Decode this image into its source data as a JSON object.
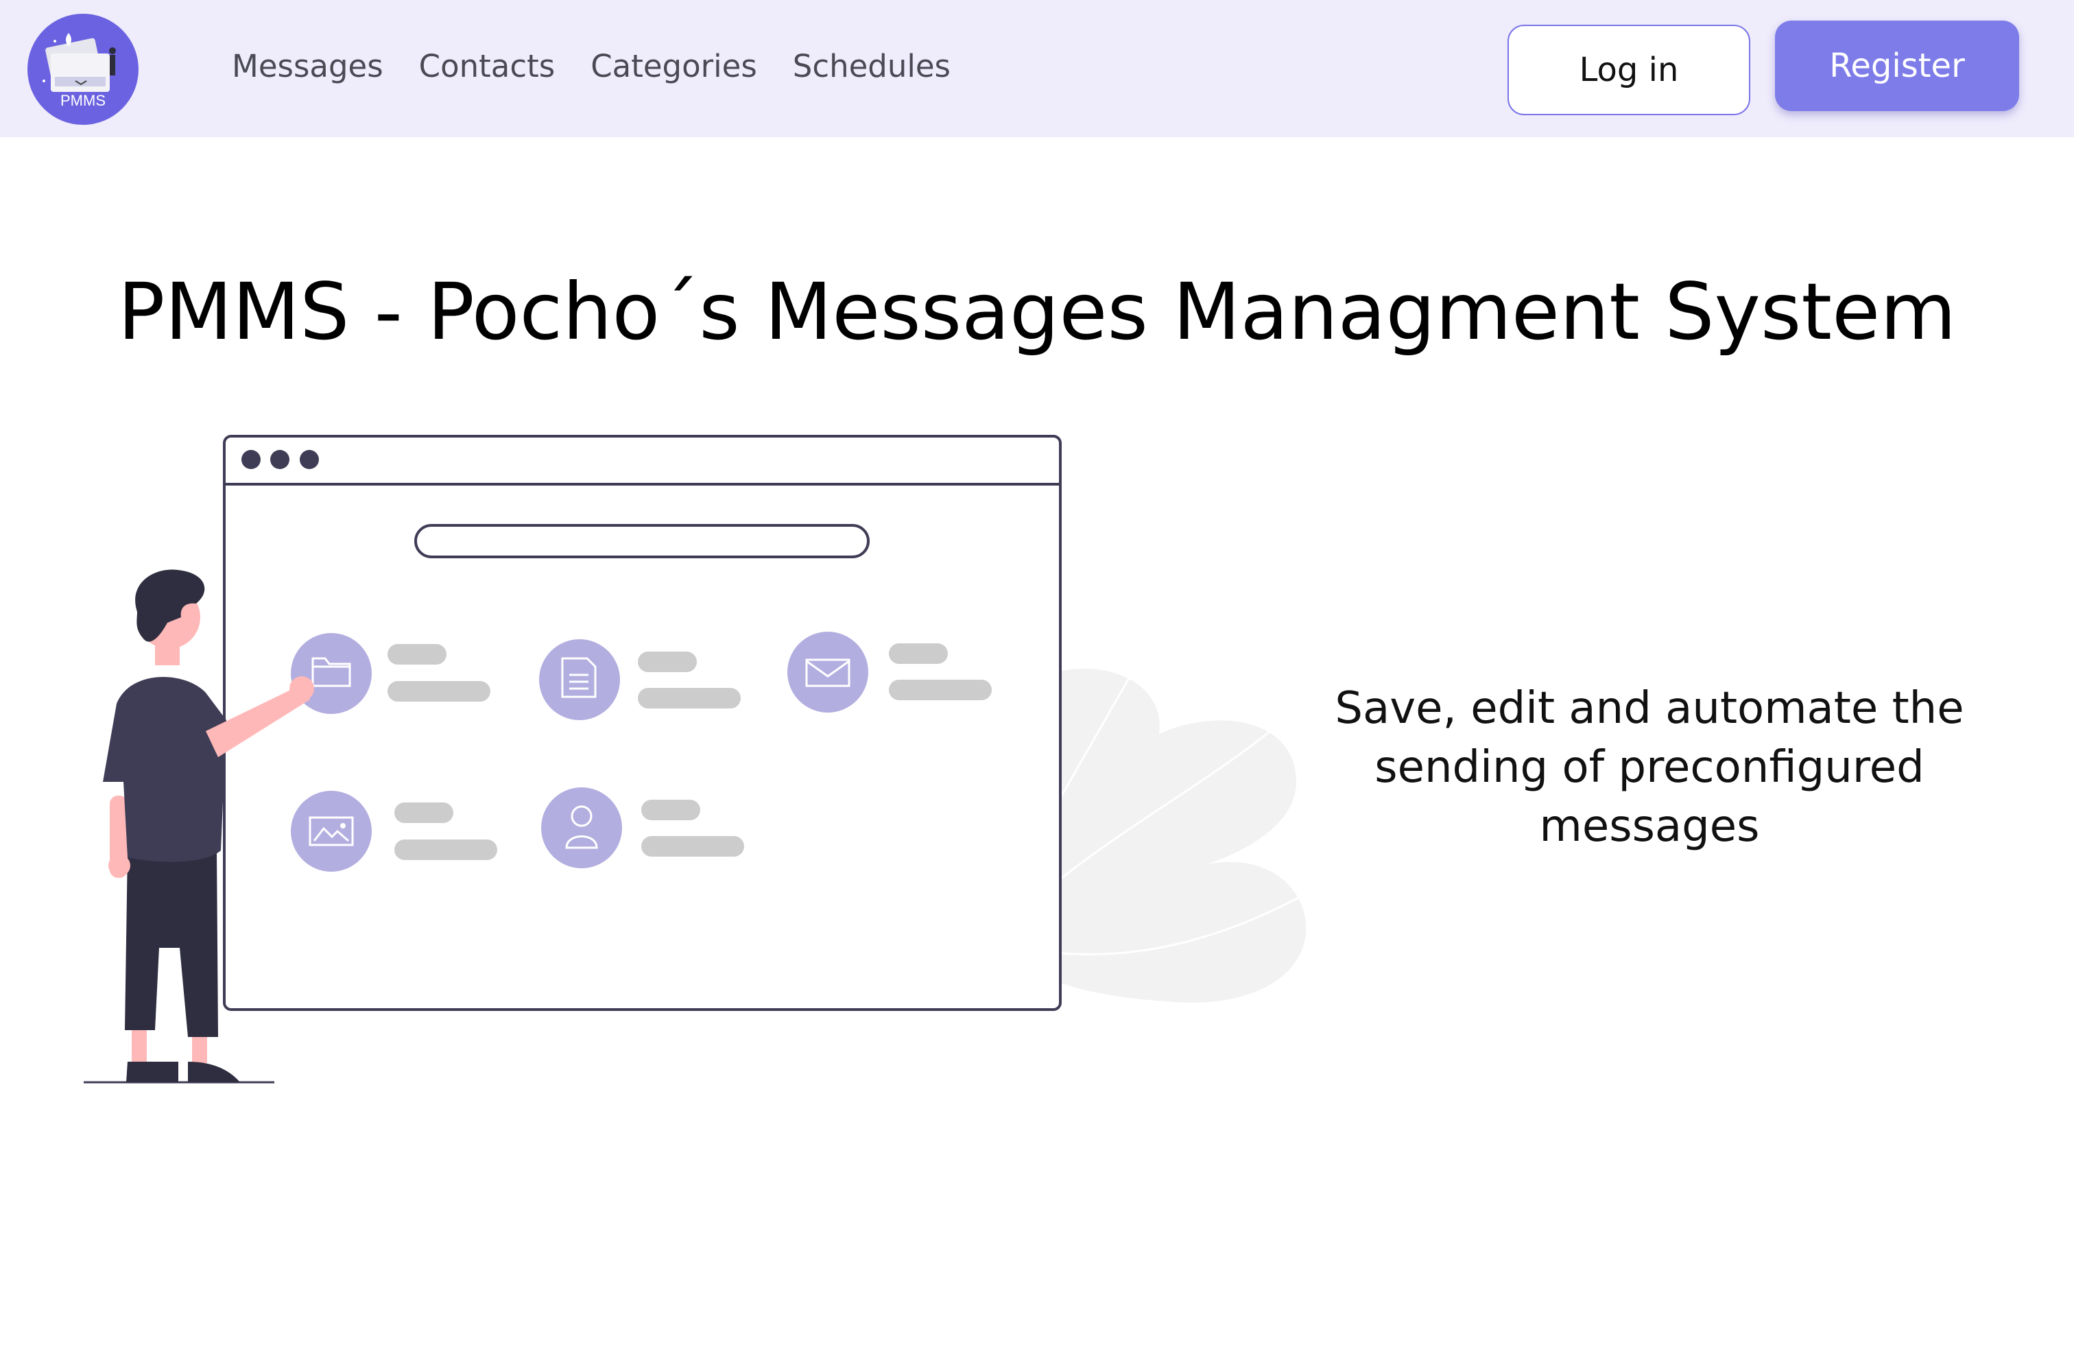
{
  "brand": {
    "logo_text": "PMMS",
    "accent_color": "#6a62e0"
  },
  "nav": {
    "items": [
      {
        "label": "Messages"
      },
      {
        "label": "Contacts"
      },
      {
        "label": "Categories"
      },
      {
        "label": "Schedules"
      }
    ],
    "login_label": "Log in",
    "register_label": "Register"
  },
  "hero": {
    "title": "PMMS - Pocho´s Messages Managment System",
    "tagline": "Save, edit and automate the sending of preconfigured messages",
    "illustration_icons": [
      "folder-icon",
      "document-icon",
      "mail-icon",
      "image-icon",
      "user-icon"
    ]
  },
  "colors": {
    "navbar_bg": "#efecfc",
    "button_primary": "#7d7ce9",
    "icon_circle": "#b3aee0"
  }
}
